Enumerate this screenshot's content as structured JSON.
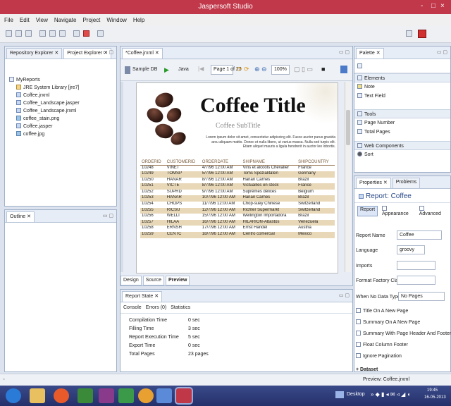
{
  "window": {
    "title": "Jaspersoft Studio",
    "controls": [
      "-",
      "□",
      "×"
    ]
  },
  "menu": [
    "File",
    "Edit",
    "View",
    "Navigate",
    "Project",
    "Window",
    "Help"
  ],
  "left_panel": {
    "tabs": [
      "Repository Explorer ✕",
      "Project Explorer ✕"
    ],
    "tree": [
      {
        "label": "MyReports",
        "indent": 0,
        "icon": "folder"
      },
      {
        "label": "JRE System Library [jre7]",
        "indent": 1,
        "icon": "book"
      },
      {
        "label": "Coffee.jrxml",
        "indent": 1,
        "icon": "rpt"
      },
      {
        "label": "Coffee_Landscape.jasper",
        "indent": 1,
        "icon": "rpt"
      },
      {
        "label": "Coffee_Landscape.jrxml",
        "indent": 1,
        "icon": "rpt"
      },
      {
        "label": "coffee_stain.png",
        "indent": 1,
        "icon": "img"
      },
      {
        "label": "Coffee.jasper",
        "indent": 1,
        "icon": "rpt"
      },
      {
        "label": "coffee.jpg",
        "indent": 1,
        "icon": "img"
      }
    ]
  },
  "outline_panel": {
    "tab": "Outline ✕"
  },
  "editor": {
    "tab": "*Coffee.jrxml ✕",
    "toolbar": {
      "adapter": "Sample DB",
      "language": "Java",
      "page": "Page 1 of 23",
      "zoom": "100%"
    },
    "bottom_tabs": [
      "Design",
      "Source",
      "Preview"
    ]
  },
  "report": {
    "title": "Coffee Title",
    "subtitle": "Coffee SubTitle",
    "lorem": "Lorem ipsum dolor sit amet, consectetur adipiscing elit. Fusce auctor purus gravida arcu aliquam mattis. Donec et nulla libero, ut varius massa. Nulla sed turpis elit. Etiam aliquet mauris a ligula hendrerit in auctor leo lobortis.",
    "columns": [
      "ORDERID",
      "CUSTOMERID",
      "ORDERDATE",
      "SHIPNAME",
      "SHIPCOUNTRY"
    ],
    "rows": [
      [
        "10248",
        "VINET",
        "4/7/96 12:00 AM",
        "Vins et alcools Chevalier",
        "France"
      ],
      [
        "10249",
        "TOMSP",
        "5/7/96 12:00 AM",
        "Toms Spezialitäten",
        "Germany"
      ],
      [
        "10250",
        "HANAR",
        "8/7/96 12:00 AM",
        "Hanari Carnes",
        "Brazil"
      ],
      [
        "10251",
        "VICTE",
        "8/7/96 12:00 AM",
        "Victuailles en stock",
        "France"
      ],
      [
        "10252",
        "SUPRD",
        "9/7/96 12:00 AM",
        "Suprêmes délices",
        "Belgium"
      ],
      [
        "10253",
        "HANAR",
        "10/7/96 12:00 AM",
        "Hanari Carnes",
        "Brazil"
      ],
      [
        "10254",
        "CHOPS",
        "11/7/96 12:00 AM",
        "Chop-suey Chinese",
        "Switzerland"
      ],
      [
        "10255",
        "RICSU",
        "12/7/96 12:00 AM",
        "Richter Supermarkt",
        "Switzerland"
      ],
      [
        "10256",
        "WELLI",
        "15/7/96 12:00 AM",
        "Wellington Importadora",
        "Brazil"
      ],
      [
        "10257",
        "HILAA",
        "16/7/96 12:00 AM",
        "HILARIÓN-Abastos",
        "Venezuela"
      ],
      [
        "10258",
        "ERNSH",
        "17/7/96 12:00 AM",
        "Ernst Handel",
        "Austria"
      ],
      [
        "10259",
        "CENTC",
        "18/7/96 12:00 AM",
        "Centro comercial",
        "Mexico"
      ]
    ]
  },
  "report_state": {
    "tab": "Report State ✕",
    "subtabs": [
      "Console",
      "Errors (0)",
      "Statistics"
    ],
    "stats": [
      {
        "label": "Compilation Time",
        "value": "0 sec"
      },
      {
        "label": "Filling Time",
        "value": "3 sec"
      },
      {
        "label": "Report Execution Time",
        "value": "5 sec"
      },
      {
        "label": "Export Time",
        "value": "0 sec"
      },
      {
        "label": "Total Pages",
        "value": "23 pages"
      }
    ]
  },
  "palette": {
    "tab": "Palette ✕",
    "sections": [
      {
        "header": "Elements",
        "items": [
          "Note",
          "Text Field"
        ]
      },
      {
        "header": "Tools",
        "items": [
          "Page Number",
          "Total Pages"
        ]
      },
      {
        "header": "Web Components",
        "items": [
          "Sort"
        ]
      }
    ]
  },
  "properties": {
    "tabs": [
      "Properties ✕",
      "Problems"
    ],
    "heading": "Report: Coffee",
    "subtabs": [
      "Report",
      "Appearance",
      "Advanced"
    ],
    "fields": {
      "report_name_label": "Report Name",
      "report_name": "Coffee",
      "language_label": "Language",
      "language": "groovy",
      "imports_label": "Imports",
      "ffc_label": "Format Factory Class",
      "when_no_data_label": "When No Data Type",
      "when_no_data": "No Pages"
    },
    "checks": [
      "Title On A New Page",
      "Summary On A New Page",
      "Summary With Page Header And Footer",
      "Float Column Footer",
      "Ignore Pagination"
    ],
    "dataset": "Dataset"
  },
  "status": {
    "text": "Preview: Coffee.jrxml"
  },
  "taskbar": {
    "desktop": "Desktop",
    "time": "19:45",
    "date": "16-05-2013"
  }
}
